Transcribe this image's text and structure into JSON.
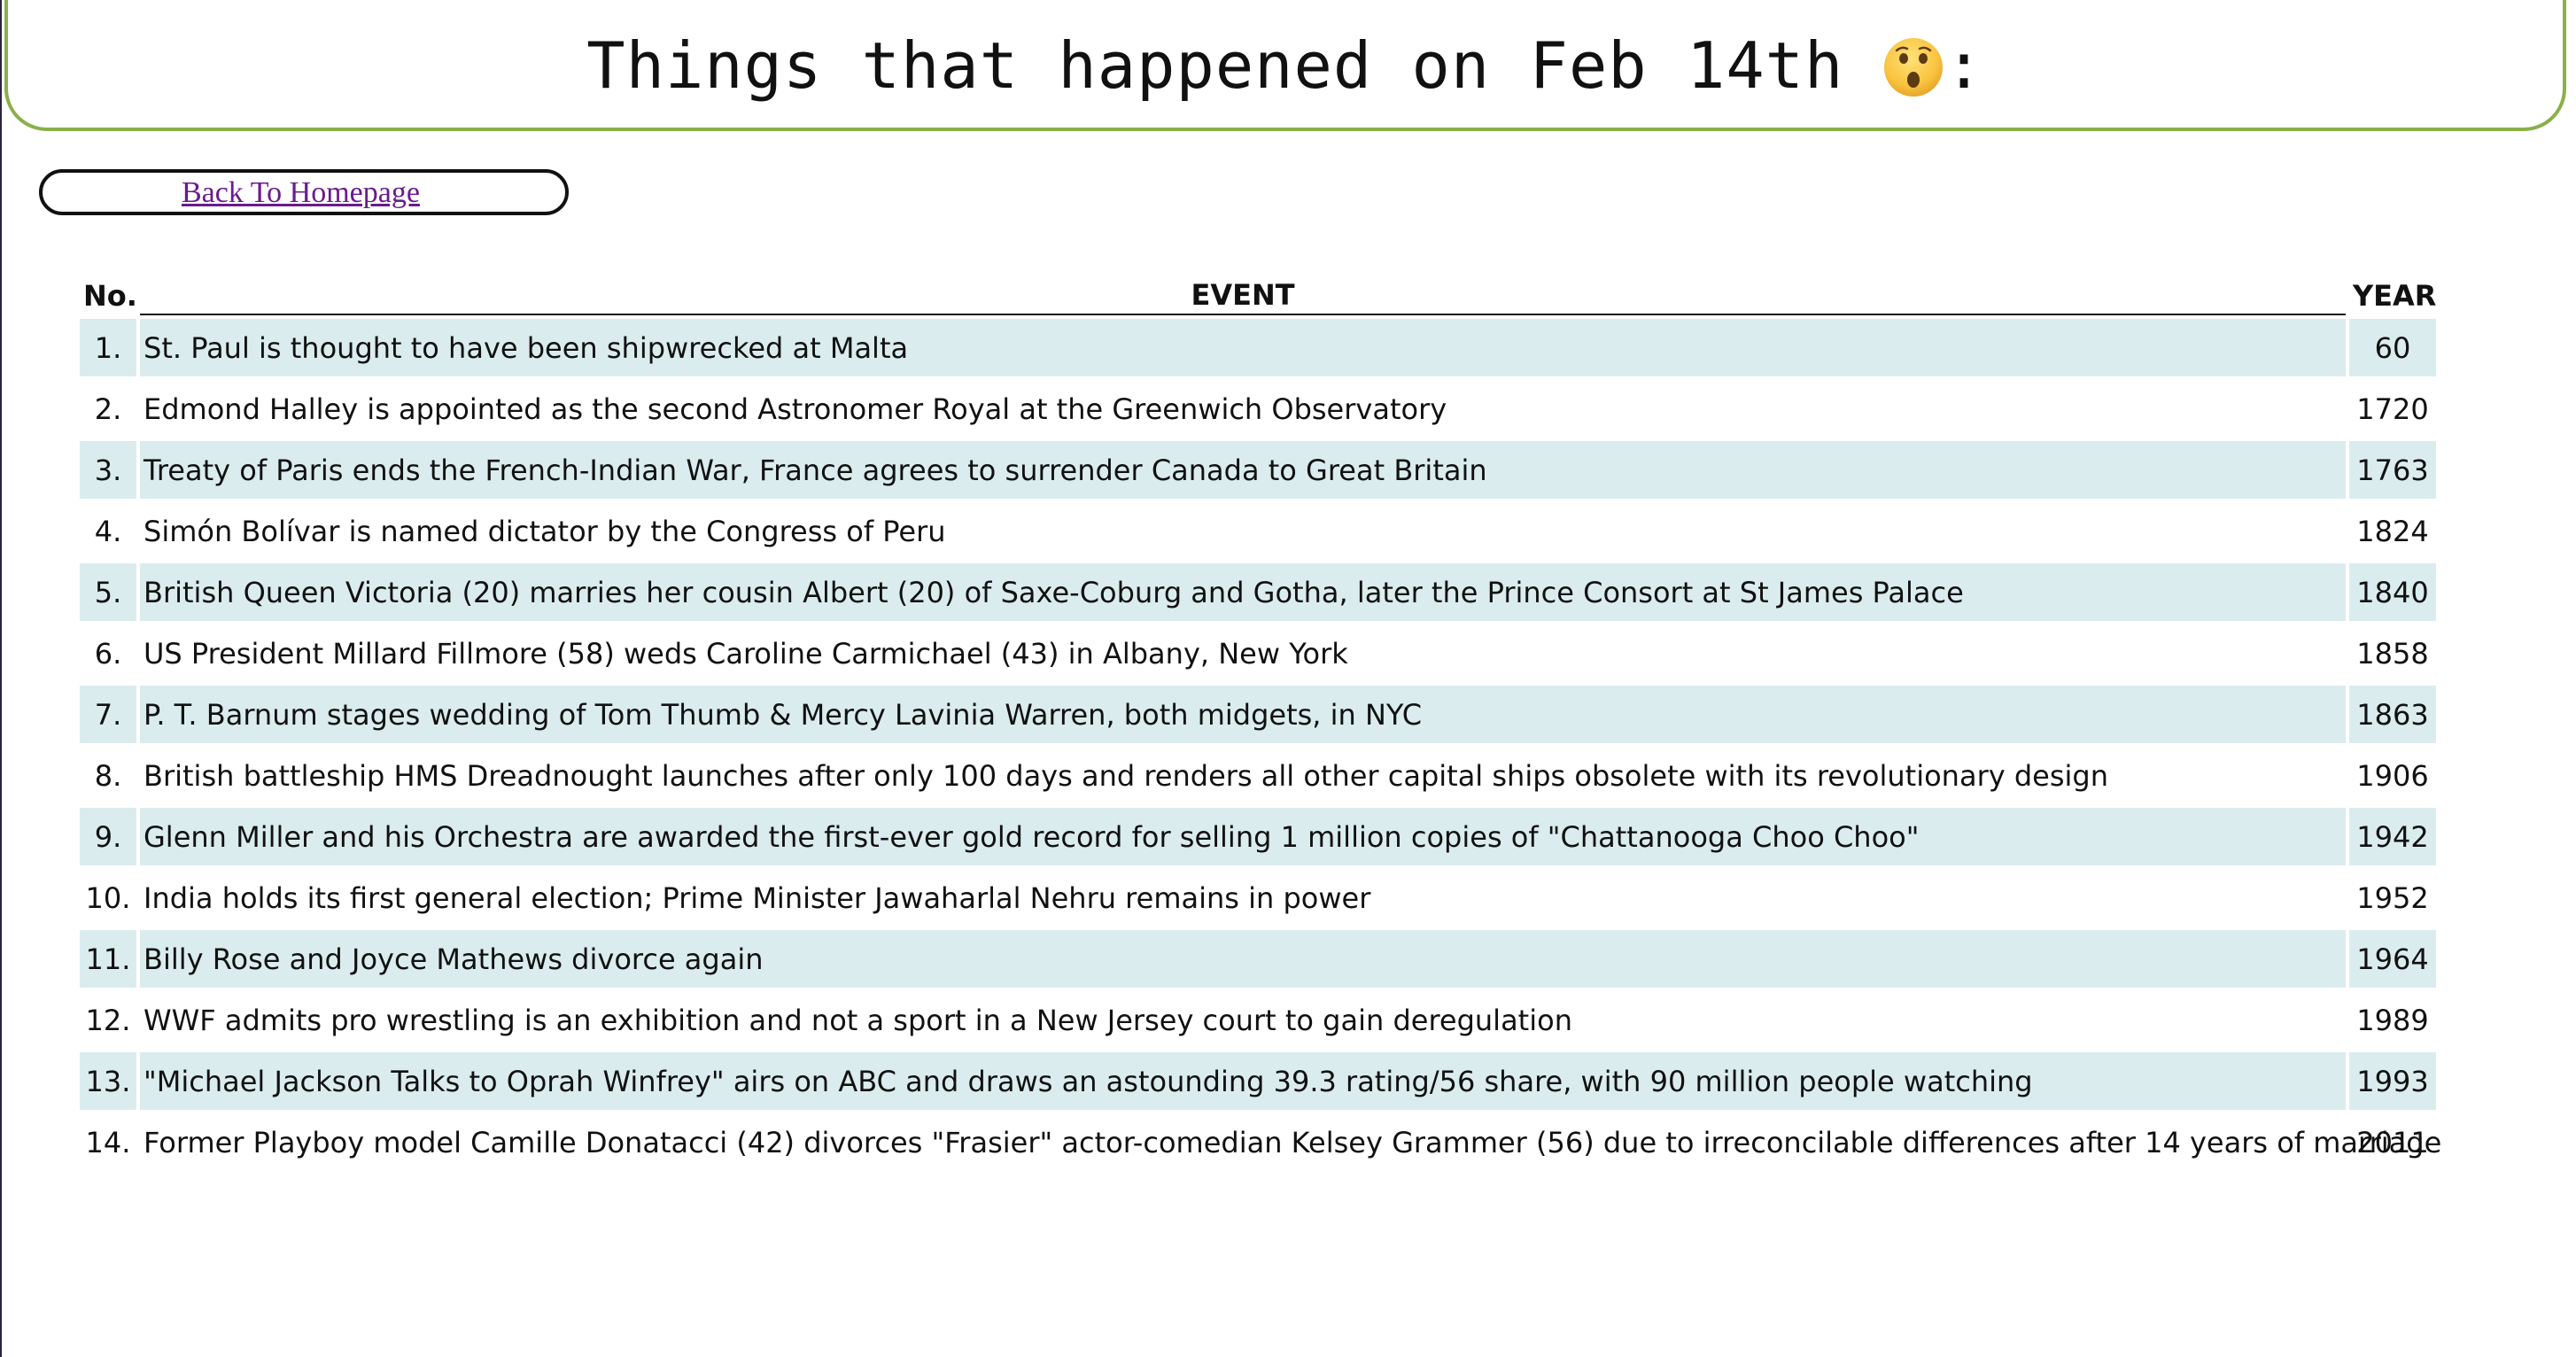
{
  "header": {
    "title": "Things that happened on Feb 14th",
    "emoji_icon": "astonished-face-icon",
    "title_suffix": ":"
  },
  "nav": {
    "back_label": "Back To Homepage"
  },
  "colors": {
    "header_border": "#8ab04a",
    "row_shade": "#daecee",
    "link": "#6b1a8f"
  },
  "table": {
    "columns": [
      "No.",
      "EVENT",
      "YEAR"
    ],
    "rows": [
      {
        "no": "1.",
        "event": "St. Paul is thought to have been shipwrecked at Malta",
        "year": "60"
      },
      {
        "no": "2.",
        "event": "Edmond Halley is appointed as the second Astronomer Royal at the Greenwich Observatory",
        "year": "1720"
      },
      {
        "no": "3.",
        "event": "Treaty of Paris ends the French-Indian War, France agrees to surrender Canada to Great Britain",
        "year": "1763"
      },
      {
        "no": "4.",
        "event": "Simón Bolívar is named dictator by the Congress of Peru",
        "year": "1824"
      },
      {
        "no": "5.",
        "event": "British Queen Victoria (20) marries her cousin Albert (20) of Saxe-Coburg and Gotha, later the Prince Consort at St James Palace",
        "year": "1840"
      },
      {
        "no": "6.",
        "event": "US President Millard Fillmore (58) weds Caroline Carmichael (43) in Albany, New York",
        "year": "1858"
      },
      {
        "no": "7.",
        "event": "P. T. Barnum stages wedding of Tom Thumb & Mercy Lavinia Warren, both midgets, in NYC",
        "year": "1863"
      },
      {
        "no": "8.",
        "event": "British battleship HMS Dreadnought launches after only 100 days and renders all other capital ships obsolete with its revolutionary design",
        "year": "1906"
      },
      {
        "no": "9.",
        "event": "Glenn Miller and his Orchestra are awarded the first-ever gold record for selling 1 million copies of \"Chattanooga Choo Choo\"",
        "year": "1942"
      },
      {
        "no": "10.",
        "event": "India holds its first general election; Prime Minister Jawaharlal Nehru remains in power",
        "year": "1952"
      },
      {
        "no": "11.",
        "event": "Billy Rose and Joyce Mathews divorce again",
        "year": "1964"
      },
      {
        "no": "12.",
        "event": "WWF admits pro wrestling is an exhibition and not a sport in a New Jersey court to gain deregulation",
        "year": "1989"
      },
      {
        "no": "13.",
        "event": "\"Michael Jackson Talks to Oprah Winfrey\" airs on ABC and draws an astounding 39.3 rating/56 share, with 90 million people watching",
        "year": "1993"
      },
      {
        "no": "14.",
        "event": "Former Playboy model Camille Donatacci (42) divorces \"Frasier\" actor-comedian Kelsey Grammer (56) due to irreconcilable differences after 14 years of marriage",
        "year": "2011"
      }
    ]
  }
}
